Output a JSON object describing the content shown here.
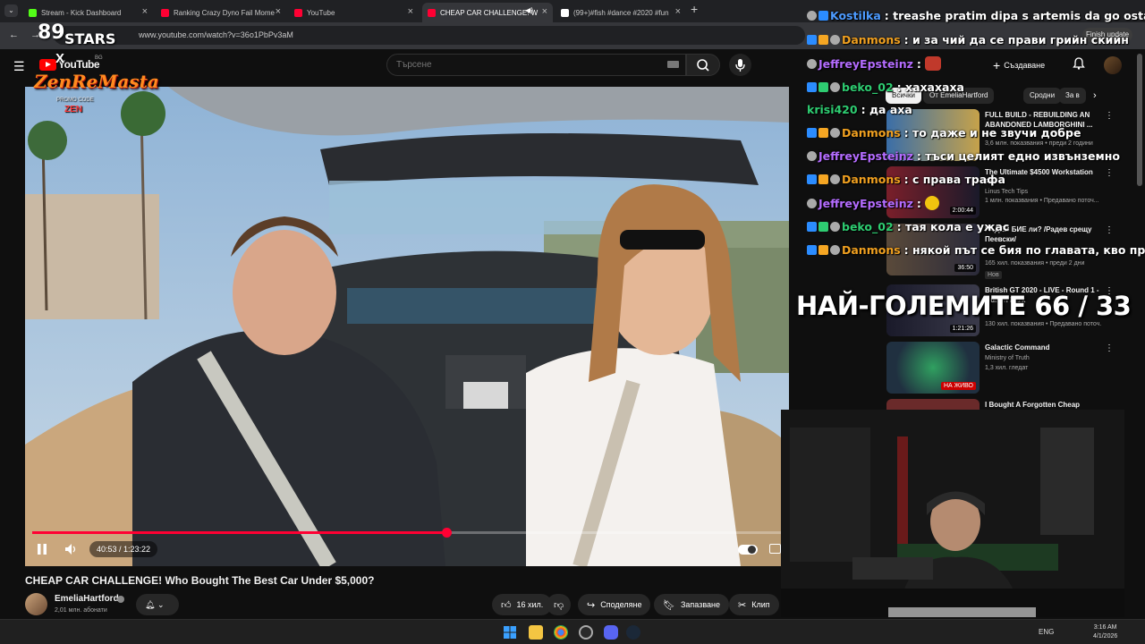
{
  "browser": {
    "tabs": [
      {
        "label": "Stream - Kick Dashboard",
        "favicon_color": "#53fc18",
        "active": false
      },
      {
        "label": "Ranking Crazy Dyno Fail Mome",
        "favicon_color": "#ff0033",
        "active": false
      },
      {
        "label": "YouTube",
        "favicon_color": "#ff0033",
        "active": false
      },
      {
        "label": "CHEAP CAR CHALLENGE! W",
        "favicon_color": "#ff0033",
        "active": true
      },
      {
        "label": "(99+)#fish #dance #2020 #fun",
        "favicon_color": "#ffffff",
        "active": false
      }
    ],
    "url": "www.youtube.com/watch?v=36o1PbPv3aM",
    "finish_update_label": "Finish update"
  },
  "youtube": {
    "logo_text": "YouTube",
    "country_code": "BG",
    "search_placeholder": "Търсене",
    "create_label": "Създаване"
  },
  "player": {
    "current_time": "40:53",
    "duration": "1:23:22",
    "time_display": "40:53 / 1:23:22",
    "progress_fraction": 0.552
  },
  "video": {
    "title": "CHEAP CAR CHALLENGE! Who Bought The Best Car Under $5,000?",
    "channel": "EmeliaHartford",
    "subscribers": "2,01 млн. абонати",
    "likes": "16 хил.",
    "share_label": "Споделяне",
    "save_label": "Запазване",
    "clip_label": "Клип"
  },
  "sidebar": {
    "chips": [
      "Всички",
      "От EmeliaHartford",
      "Сродни",
      "За в"
    ],
    "recommendations": [
      {
        "title": "FULL BUILD - REBUILDING AN ABANDONED LAMBORGHINI ...",
        "channel": "",
        "meta": "3,6 млн. показвания • преди 2 години",
        "duration": "",
        "thumb": "#3a6ea8"
      },
      {
        "title": "The Ultimate $4500 Workstation PC",
        "channel": "Linus Tech Tips",
        "meta": "1 млн. показвания • Предавано поточ...",
        "duration": "2:00:44",
        "thumb": "#7a1f2a"
      },
      {
        "title": "РАДЕВ БИЕ ли? /Радев срещу Пеевски/",
        "channel": "",
        "meta": "165 хил. показвания • преди 2 дни",
        "duration": "36:50",
        "badge": "Нов",
        "thumb": "#5a4a3a"
      },
      {
        "title": "British GT 2020 - LIVE - Round 1 - Oulton Park",
        "channel": "",
        "meta": "130 хил. показвания • Предавано поточ...",
        "duration": "1:21:26",
        "thumb": "#1a1a2a"
      },
      {
        "title": "Galactic Command",
        "channel": "Ministry of Truth",
        "meta": "1,3 хил. гледат",
        "live": "НА ЖИВО",
        "thumb": "#203040"
      },
      {
        "title": "I Bought A Forgotten Cheap",
        "channel": "",
        "meta": "",
        "duration": "",
        "thumb": "#6a2a2a"
      }
    ]
  },
  "stream_overlay": {
    "brand_number": "89",
    "brand_stars": "STARS",
    "brand_x": "X",
    "brand_name": "ZenReMasta",
    "promo_label": "PROMO CODE",
    "promo_code": "ZEN",
    "counter_text": "НАЙ-ГОЛЕМИТЕ 66 / 33",
    "chat": [
      {
        "user": "Kostilka",
        "color": "#4d9bff",
        "text": "treashe pratim dipa s artemis da go ostaqt r"
      },
      {
        "user": "Danmons",
        "color": "#f0a020",
        "text": "и за чий да се прави грийн скийн"
      },
      {
        "user": "JeffreyEpsteinz",
        "color": "#b46cff",
        "text": ""
      },
      {
        "user": "beko_02",
        "color": "#2ecc71",
        "text": "хахахаха"
      },
      {
        "user": "krisi420",
        "color": "#2ecc71",
        "text": "да аха"
      },
      {
        "user": "Danmons",
        "color": "#f0a020",
        "text": "то даже и не звучи добре"
      },
      {
        "user": "JeffreyEpsteinz",
        "color": "#b46cff",
        "text": "тъси целият едно извънземно"
      },
      {
        "user": "Danmons",
        "color": "#f0a020",
        "text": "с права трафа"
      },
      {
        "user": "JeffreyEpsteinz",
        "color": "#b46cff",
        "text": ""
      },
      {
        "user": "beko_02",
        "color": "#2ecc71",
        "text": "тая кола е ужас"
      },
      {
        "user": "Danmons",
        "color": "#f0a020",
        "text": "някой път се бия по главата, кво правя"
      }
    ]
  },
  "taskbar": {
    "language": "ENG",
    "time": "3:16 AM",
    "date": "4/1/2026"
  }
}
